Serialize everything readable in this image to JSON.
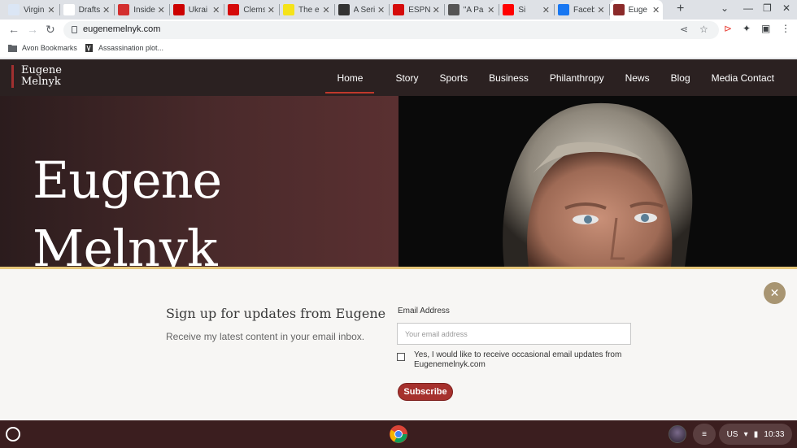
{
  "browser": {
    "tabs": [
      {
        "title": "Virgin",
        "icon": "mail-icon",
        "color": "#dbe6f5"
      },
      {
        "title": "Drafts",
        "icon": "wix-icon",
        "color": "#ffffff"
      },
      {
        "title": "Inside",
        "icon": "news-icon",
        "color": "#d32f2f"
      },
      {
        "title": "Ukrai",
        "icon": "cnn-icon",
        "color": "#cc0000"
      },
      {
        "title": "Clems",
        "icon": "espn-icon",
        "color": "#d50a0a"
      },
      {
        "title": "The e",
        "icon": "v-icon",
        "color": "#f5e31a"
      },
      {
        "title": "A Seri",
        "icon": "film-icon",
        "color": "#333333"
      },
      {
        "title": "ESPN",
        "icon": "espn-icon",
        "color": "#d50a0a"
      },
      {
        "title": "\"A Pa",
        "icon": "clock-icon",
        "color": "#555555"
      },
      {
        "title": "Si",
        "icon": "youtube-icon",
        "color": "#ff0000"
      },
      {
        "title": "Faceb",
        "icon": "facebook-icon",
        "color": "#1877f2"
      },
      {
        "title": "Euge",
        "icon": "e-logo-icon",
        "color": "#8b2a2a"
      }
    ],
    "url": "eugenemelnyk.com",
    "bookmarks": [
      {
        "label": "Avon Bookmarks",
        "icon": "folder-icon"
      },
      {
        "label": "Assassination plot...",
        "icon": "page-icon"
      }
    ]
  },
  "site": {
    "logo_line1": "Eugene",
    "logo_line2": "Melnyk",
    "nav": [
      "Home",
      "Story",
      "Sports",
      "Business",
      "Philanthropy",
      "News",
      "Blog",
      "Media Contact"
    ],
    "active_nav": "Home",
    "hero_line1": "Eugene",
    "hero_line2": "Melnyk"
  },
  "signup": {
    "title": "Sign up for updates from Eugene",
    "subtitle": "Receive my latest content in your email inbox.",
    "email_label": "Email Address",
    "email_placeholder": "Your email address",
    "consent_line1": "Yes, I would like to receive occasional email updates from",
    "consent_line2": "Eugenemelnyk.com",
    "button": "Subscribe",
    "close_symbol": "✕"
  },
  "shelf": {
    "ime": "US",
    "time": "10:33"
  },
  "colors": {
    "header_bg": "#2b2121",
    "accent_red": "#a6312d",
    "hero_maroon": "#5a3031",
    "signup_gold": "#e6c77a"
  }
}
